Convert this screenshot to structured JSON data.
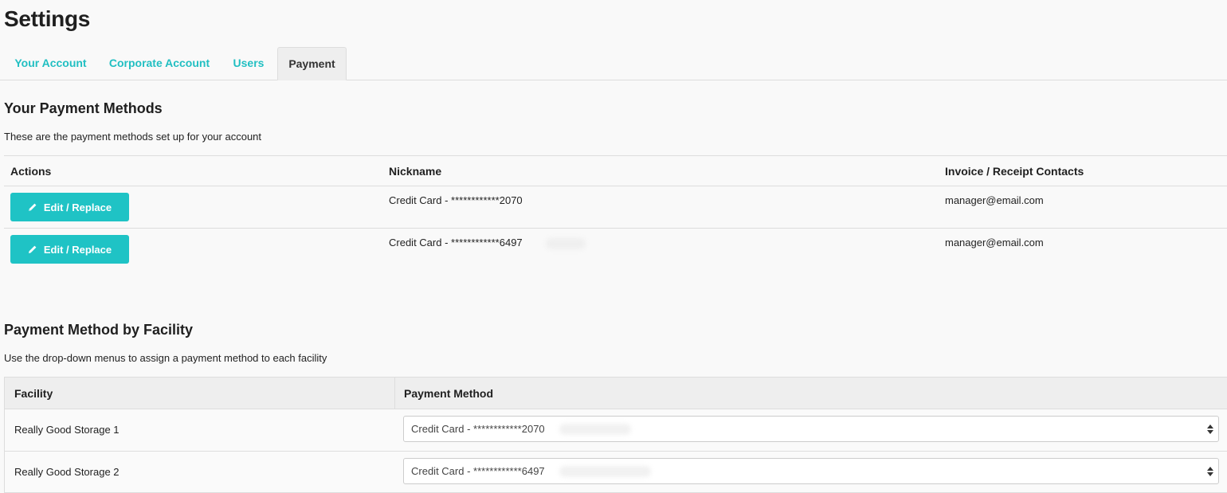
{
  "page": {
    "title": "Settings"
  },
  "tabs": [
    {
      "label": "Your Account",
      "active": false
    },
    {
      "label": "Corporate Account",
      "active": false
    },
    {
      "label": "Users",
      "active": false
    },
    {
      "label": "Payment",
      "active": true
    }
  ],
  "payment_methods": {
    "title": "Your Payment Methods",
    "description": "These are the payment methods set up for your account",
    "columns": [
      "Actions",
      "Nickname",
      "Invoice / Receipt Contacts"
    ],
    "rows": [
      {
        "action_label": "Edit / Replace",
        "nickname": "Credit Card - ************2070",
        "contact": "manager@email.com"
      },
      {
        "action_label": "Edit / Replace",
        "nickname": "Credit Card - ************6497",
        "contact": "manager@email.com"
      }
    ]
  },
  "facility": {
    "title": "Payment Method by Facility",
    "description": "Use the drop-down menus to assign a payment method to each facility",
    "columns": [
      "Facility",
      "Payment Method"
    ],
    "rows": [
      {
        "name": "Really Good Storage 1",
        "method": "Credit Card - ************2070"
      },
      {
        "name": "Really Good Storage 2",
        "method": "Credit Card - ************6497"
      }
    ]
  },
  "colors": {
    "accent": "#1fc3c5",
    "tab_link": "#21bfc2",
    "background": "#f9f9f9"
  },
  "icons": {
    "edit": "pencil-icon",
    "select": "select-arrows-icon"
  }
}
